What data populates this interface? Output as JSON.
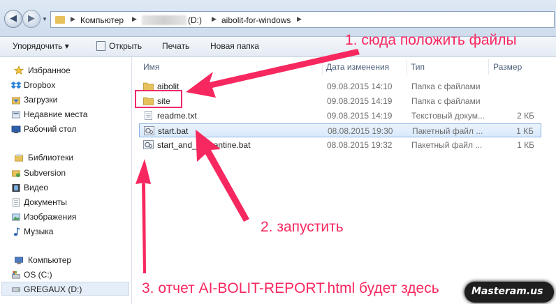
{
  "address_bar": {
    "crumbs": [
      "Компьютер",
      "(D:)",
      "aibolit-for-windows"
    ]
  },
  "toolbar": {
    "organize": "Упорядочить ▾",
    "open": "Открыть",
    "print": "Печать",
    "new_folder": "Новая папка"
  },
  "sidebar": {
    "favorites": "Избранное",
    "dropbox": "Dropbox",
    "downloads": "Загрузки",
    "recent": "Недавние места",
    "desktop": "Рабочий стол",
    "libraries": "Библиотеки",
    "subversion": "Subversion",
    "video": "Видео",
    "documents": "Документы",
    "images": "Изображения",
    "music": "Музыка",
    "computer": "Компьютер",
    "os": "OS (C:)",
    "gregaux": "GREGAUX (D:)"
  },
  "columns": {
    "name": "Имя",
    "date": "Дата изменения",
    "type": "Тип",
    "size": "Размер"
  },
  "files": [
    {
      "name": "aibolit",
      "date": "09.08.2015 14:10",
      "type": "Папка с файлами",
      "size": "",
      "icon": "folder-icon"
    },
    {
      "name": "site",
      "date": "09.08.2015 14:19",
      "type": "Папка с файлами",
      "size": "",
      "icon": "folder-icon"
    },
    {
      "name": "readme.txt",
      "date": "09.08.2015 14:19",
      "type": "Текстовый докум...",
      "size": "2 КБ",
      "icon": "text-file-icon"
    },
    {
      "name": "start.bat",
      "date": "08.08.2015 19:30",
      "type": "Пакетный файл ...",
      "size": "1 КБ",
      "icon": "batch-file-icon"
    },
    {
      "name": "start_and_quarantine.bat",
      "date": "08.08.2015 19:32",
      "type": "Пакетный файл ...",
      "size": "1 КБ",
      "icon": "batch-file-icon"
    }
  ],
  "annotations": {
    "step1": "1. сюда положить файлы",
    "step2": "2. запустить",
    "step3": "3. отчет AI-BOLIT-REPORT.html будет здесь"
  },
  "watermark": "Masteram.us",
  "colors": {
    "annotation": "#f7285f",
    "selection": "#d9e9fb",
    "folder": "#e6c15c"
  }
}
